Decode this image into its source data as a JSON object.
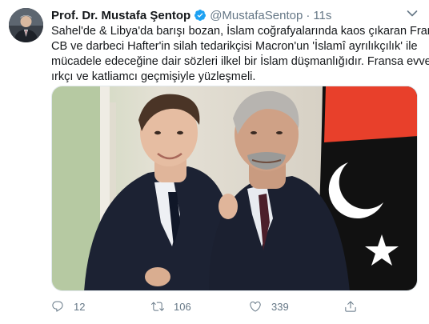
{
  "tweet": {
    "display_name": "Prof. Dr. Mustafa Şentop",
    "handle": "@MustafaSentop",
    "separator": "·",
    "time": "11s",
    "text_lines": [
      "Sahel'de & Libya'da barışı bozan, İslam coğrafyalarında kaos çıkaran Fransa",
      "CB ve darbeci Hafter'in silah tedarikçisi Macron'un 'İslamî ayrılıkçılık' ile",
      "mücadele edeceğine dair sözleri ilkel bir İslam düşmanlığıdır. Fransa evvelâ",
      "ırkçı ve katliamcı geçmişiyle yüzleşmeli."
    ],
    "verified": true
  },
  "actions": {
    "reply_count": "12",
    "retweet_count": "106",
    "like_count": "339"
  },
  "icons": {
    "verified": "verified-badge-icon",
    "caret": "chevron-down-icon",
    "reply": "reply-icon",
    "retweet": "retweet-icon",
    "like": "heart-icon",
    "share": "share-icon"
  },
  "colors": {
    "name_text": "#14171a",
    "secondary_text": "#657786",
    "verified_blue": "#1da1f2",
    "flag_red": "#e8402b",
    "flag_black": "#111111",
    "flag_green": "#239e46"
  }
}
